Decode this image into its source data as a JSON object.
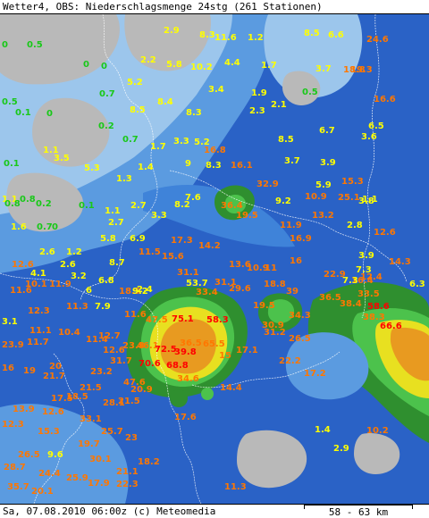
{
  "header": {
    "title": "Wetter4, OBS: Niederschlagsmenge 24stg (261 Stationen)"
  },
  "footer": {
    "timestamp": "Sa, 07.08.2010 06:00z (c) Meteomedia",
    "scale": "58 - 63 km"
  },
  "colors": {
    "background": "#2a62c6",
    "light_blue": "#5b9be0",
    "pale_blue": "#9cc6ec",
    "grey": "#b9b9b9",
    "cyan_blue": "#3f83d9",
    "green": "#2f8f2f",
    "light_green": "#4cc24c",
    "yellow": "#e8e020",
    "orange": "#e89a20",
    "red": "#e02020",
    "label_green": "#19c819",
    "label_yellow": "#ffff00",
    "label_orange": "#ff7700",
    "label_red": "#ff0000"
  },
  "stations": [
    {
      "v": "0.5",
      "c": "green"
    },
    {
      "v": "0",
      "c": "green"
    },
    {
      "v": "2.9",
      "c": "yellow"
    },
    {
      "v": "8.3",
      "c": "yellow"
    },
    {
      "v": "11.6",
      "c": "yellow"
    },
    {
      "v": "1.2",
      "c": "yellow"
    },
    {
      "v": "8.5",
      "c": "yellow"
    },
    {
      "v": "6.6",
      "c": "yellow"
    },
    {
      "v": "24.6",
      "c": "orange"
    },
    {
      "v": "2.2",
      "c": "yellow"
    },
    {
      "v": "5.8",
      "c": "yellow"
    },
    {
      "v": "10.2",
      "c": "yellow"
    },
    {
      "v": "4.4",
      "c": "yellow"
    },
    {
      "v": "1.7",
      "c": "yellow"
    },
    {
      "v": "3.7",
      "c": "yellow"
    },
    {
      "v": "18.8",
      "c": "orange"
    },
    {
      "v": "19.3",
      "c": "orange"
    },
    {
      "v": "0",
      "c": "green"
    },
    {
      "v": "0",
      "c": "green"
    },
    {
      "v": "5.2",
      "c": "yellow"
    },
    {
      "v": "3.4",
      "c": "yellow"
    },
    {
      "v": "1.9",
      "c": "yellow"
    },
    {
      "v": "0.5",
      "c": "green"
    },
    {
      "v": "0.5",
      "c": "green"
    },
    {
      "v": "0.7",
      "c": "green"
    },
    {
      "v": "8.5",
      "c": "yellow"
    },
    {
      "v": "8.4",
      "c": "yellow"
    },
    {
      "v": "8.3",
      "c": "yellow"
    },
    {
      "v": "2.3",
      "c": "yellow"
    },
    {
      "v": "2.1",
      "c": "yellow"
    },
    {
      "v": "16.6",
      "c": "orange"
    },
    {
      "v": "0",
      "c": "green"
    },
    {
      "v": "0.1",
      "c": "green"
    },
    {
      "v": "0.2",
      "c": "green"
    },
    {
      "v": "6.7",
      "c": "yellow"
    },
    {
      "v": "6.5",
      "c": "yellow"
    },
    {
      "v": "3.6",
      "c": "yellow"
    },
    {
      "v": "0.7",
      "c": "green"
    },
    {
      "v": "1.7",
      "c": "yellow"
    },
    {
      "v": "3.3",
      "c": "yellow"
    },
    {
      "v": "5.2",
      "c": "yellow"
    },
    {
      "v": "8.5",
      "c": "yellow"
    },
    {
      "v": "1.1",
      "c": "yellow"
    },
    {
      "v": "3.5",
      "c": "yellow"
    },
    {
      "v": "16.8",
      "c": "orange"
    },
    {
      "v": "0.1",
      "c": "green"
    },
    {
      "v": "5.3",
      "c": "yellow"
    },
    {
      "v": "1.4",
      "c": "yellow"
    },
    {
      "v": "9",
      "c": "yellow"
    },
    {
      "v": "8.3",
      "c": "yellow"
    },
    {
      "v": "16.1",
      "c": "orange"
    },
    {
      "v": "3.7",
      "c": "yellow"
    },
    {
      "v": "3.9",
      "c": "yellow"
    },
    {
      "v": "1.3",
      "c": "yellow"
    },
    {
      "v": "0.8",
      "c": "green"
    },
    {
      "v": "1.1",
      "c": "yellow"
    },
    {
      "v": "15.3",
      "c": "orange"
    },
    {
      "v": "32.9",
      "c": "orange"
    },
    {
      "v": "5.9",
      "c": "yellow"
    },
    {
      "v": "0.8",
      "c": "green"
    },
    {
      "v": "0.2",
      "c": "green"
    },
    {
      "v": "0.1",
      "c": "green"
    },
    {
      "v": "7.6",
      "c": "yellow"
    },
    {
      "v": "10.9",
      "c": "orange"
    },
    {
      "v": "25.1",
      "c": "orange"
    },
    {
      "v": "1.1",
      "c": "yellow"
    },
    {
      "v": "1.1",
      "c": "yellow"
    },
    {
      "v": "2.7",
      "c": "yellow"
    },
    {
      "v": "8.2",
      "c": "yellow"
    },
    {
      "v": "36.4",
      "c": "orange"
    },
    {
      "v": "9.2",
      "c": "yellow"
    },
    {
      "v": "3.8",
      "c": "yellow"
    },
    {
      "v": "3.3",
      "c": "yellow"
    },
    {
      "v": "19.5",
      "c": "orange"
    },
    {
      "v": "13.2",
      "c": "orange"
    },
    {
      "v": "1.6",
      "c": "yellow"
    },
    {
      "v": "0.7",
      "c": "green"
    },
    {
      "v": "0",
      "c": "green"
    },
    {
      "v": "2.7",
      "c": "yellow"
    },
    {
      "v": "11.9",
      "c": "orange"
    },
    {
      "v": "2.8",
      "c": "yellow"
    },
    {
      "v": "12.6",
      "c": "orange"
    },
    {
      "v": "5.8",
      "c": "yellow"
    },
    {
      "v": "6.9",
      "c": "yellow"
    },
    {
      "v": "17.3",
      "c": "orange"
    },
    {
      "v": "16.9",
      "c": "orange"
    },
    {
      "v": "2.6",
      "c": "yellow"
    },
    {
      "v": "1.2",
      "c": "yellow"
    },
    {
      "v": "14.2",
      "c": "orange"
    },
    {
      "v": "3.9",
      "c": "yellow"
    },
    {
      "v": "11.5",
      "c": "orange"
    },
    {
      "v": "15.6",
      "c": "orange"
    },
    {
      "v": "7.3",
      "c": "yellow"
    },
    {
      "v": "14.3",
      "c": "orange"
    },
    {
      "v": "12.6",
      "c": "orange"
    },
    {
      "v": "2.6",
      "c": "yellow"
    },
    {
      "v": "8.7",
      "c": "yellow"
    },
    {
      "v": "13.6",
      "c": "orange"
    },
    {
      "v": "10.9",
      "c": "orange"
    },
    {
      "v": "11",
      "c": "orange"
    },
    {
      "v": "16",
      "c": "orange"
    },
    {
      "v": "4.1",
      "c": "yellow"
    },
    {
      "v": "3.2",
      "c": "yellow"
    },
    {
      "v": "31.1",
      "c": "orange"
    },
    {
      "v": "22.9",
      "c": "orange"
    },
    {
      "v": "16.4",
      "c": "orange"
    },
    {
      "v": "10.1",
      "c": "orange"
    },
    {
      "v": "11.9",
      "c": "orange"
    },
    {
      "v": "6.8",
      "c": "yellow"
    },
    {
      "v": "31.1",
      "c": "orange"
    },
    {
      "v": "53.7",
      "c": "yellow"
    },
    {
      "v": "18.8",
      "c": "orange"
    },
    {
      "v": "7.3",
      "c": "yellow"
    },
    {
      "v": "12.4",
      "c": "orange"
    },
    {
      "v": "6.3",
      "c": "yellow"
    },
    {
      "v": "11.6",
      "c": "orange"
    },
    {
      "v": "6",
      "c": "yellow"
    },
    {
      "v": "18.9",
      "c": "orange"
    },
    {
      "v": "2.4",
      "c": "yellow"
    },
    {
      "v": "33.4",
      "c": "orange"
    },
    {
      "v": "29.6",
      "c": "orange"
    },
    {
      "v": "39",
      "c": "orange"
    },
    {
      "v": "36.5",
      "c": "orange"
    },
    {
      "v": "33.5",
      "c": "orange"
    },
    {
      "v": "11.3",
      "c": "orange"
    },
    {
      "v": "7.9",
      "c": "yellow"
    },
    {
      "v": "9.2",
      "c": "yellow"
    },
    {
      "v": "38.4",
      "c": "orange"
    },
    {
      "v": "58.6",
      "c": "red"
    },
    {
      "v": "12.3",
      "c": "orange"
    },
    {
      "v": "11.6",
      "c": "orange"
    },
    {
      "v": "19.5",
      "c": "orange"
    },
    {
      "v": "34.3",
      "c": "orange"
    },
    {
      "v": "38.3",
      "c": "orange"
    },
    {
      "v": "3.1",
      "c": "yellow"
    },
    {
      "v": "47.5",
      "c": "orange"
    },
    {
      "v": "75.1",
      "c": "red"
    },
    {
      "v": "58.3",
      "c": "red"
    },
    {
      "v": "11.1",
      "c": "orange"
    },
    {
      "v": "10.4",
      "c": "orange"
    },
    {
      "v": "30.9",
      "c": "orange"
    },
    {
      "v": "66.6",
      "c": "red"
    },
    {
      "v": "11.7",
      "c": "orange"
    },
    {
      "v": "11.4",
      "c": "orange"
    },
    {
      "v": "31.2",
      "c": "orange"
    },
    {
      "v": "23.9",
      "c": "orange"
    },
    {
      "v": "26.5",
      "c": "orange"
    },
    {
      "v": "12.7",
      "c": "orange"
    },
    {
      "v": "23.8",
      "c": "orange"
    },
    {
      "v": "46.1",
      "c": "orange"
    },
    {
      "v": "36.5",
      "c": "orange"
    },
    {
      "v": "65.5",
      "c": "orange"
    },
    {
      "v": "12.6",
      "c": "orange"
    },
    {
      "v": "72.5",
      "c": "red"
    },
    {
      "v": "39.8",
      "c": "red"
    },
    {
      "v": "15",
      "c": "orange"
    },
    {
      "v": "17.1",
      "c": "orange"
    },
    {
      "v": "31.7",
      "c": "orange"
    },
    {
      "v": "22.2",
      "c": "orange"
    },
    {
      "v": "16",
      "c": "orange"
    },
    {
      "v": "20",
      "c": "orange"
    },
    {
      "v": "70.6",
      "c": "red"
    },
    {
      "v": "68.8",
      "c": "red"
    },
    {
      "v": "19",
      "c": "orange"
    },
    {
      "v": "23.2",
      "c": "orange"
    },
    {
      "v": "17.2",
      "c": "orange"
    },
    {
      "v": "21.7",
      "c": "orange"
    },
    {
      "v": "47.6",
      "c": "orange"
    },
    {
      "v": "34.6",
      "c": "orange"
    },
    {
      "v": "21.5",
      "c": "orange"
    },
    {
      "v": "20.9",
      "c": "orange"
    },
    {
      "v": "14.4",
      "c": "orange"
    },
    {
      "v": "17.5",
      "c": "orange"
    },
    {
      "v": "18.5",
      "c": "orange"
    },
    {
      "v": "13.9",
      "c": "orange"
    },
    {
      "v": "12.6",
      "c": "orange"
    },
    {
      "v": "28.1",
      "c": "orange"
    },
    {
      "v": "21.5",
      "c": "orange"
    },
    {
      "v": "17.6",
      "c": "orange"
    },
    {
      "v": "12.3",
      "c": "orange"
    },
    {
      "v": "33.1",
      "c": "orange"
    },
    {
      "v": "15.3",
      "c": "orange"
    },
    {
      "v": "25.7",
      "c": "orange"
    },
    {
      "v": "23",
      "c": "orange"
    },
    {
      "v": "1.4",
      "c": "yellow"
    },
    {
      "v": "10.2",
      "c": "orange"
    },
    {
      "v": "26.5",
      "c": "orange"
    },
    {
      "v": "19.7",
      "c": "orange"
    },
    {
      "v": "2.9",
      "c": "yellow"
    },
    {
      "v": "9.6",
      "c": "yellow"
    },
    {
      "v": "30.1",
      "c": "orange"
    },
    {
      "v": "28.7",
      "c": "orange"
    },
    {
      "v": "21.1",
      "c": "orange"
    },
    {
      "v": "18.2",
      "c": "orange"
    },
    {
      "v": "24.4",
      "c": "orange"
    },
    {
      "v": "25.9",
      "c": "orange"
    },
    {
      "v": "35.7",
      "c": "orange"
    },
    {
      "v": "20.1",
      "c": "orange"
    },
    {
      "v": "17.9",
      "c": "orange"
    },
    {
      "v": "22.3",
      "c": "orange"
    },
    {
      "v": "11.3",
      "c": "orange"
    }
  ]
}
